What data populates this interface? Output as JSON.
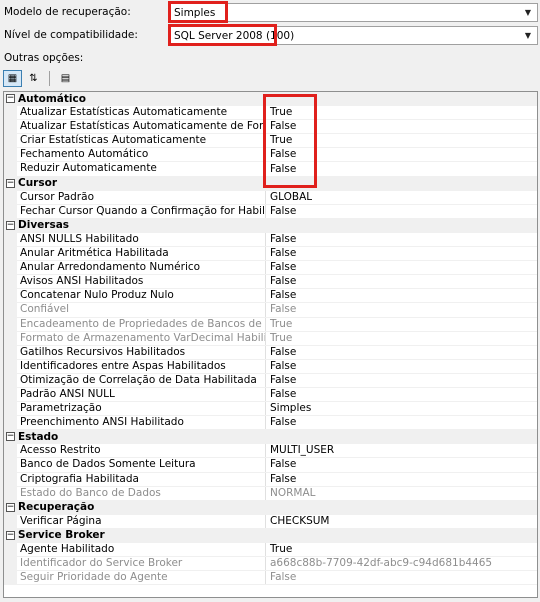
{
  "recovery": {
    "label": "Modelo de recuperação:",
    "value": "Simples"
  },
  "compat": {
    "label": "Nível de compatibilidade:",
    "value": "SQL Server 2008 (100)"
  },
  "other_options_label": "Outras opções:",
  "highlight_color": "#e0201c",
  "categories": [
    {
      "label": "Automático",
      "rows": [
        {
          "name": "Atualizar Estatísticas Automaticamente",
          "value": "True",
          "disabled": false
        },
        {
          "name": "Atualizar Estatísticas Automaticamente de Forma Assíncrona",
          "value": "False",
          "disabled": false
        },
        {
          "name": "Criar Estatísticas Automaticamente",
          "value": "True",
          "disabled": false
        },
        {
          "name": "Fechamento Automático",
          "value": "False",
          "disabled": false
        },
        {
          "name": "Reduzir Automaticamente",
          "value": "False",
          "disabled": false
        }
      ]
    },
    {
      "label": "Cursor",
      "rows": [
        {
          "name": "Cursor Padrão",
          "value": "GLOBAL",
          "disabled": false
        },
        {
          "name": "Fechar Cursor Quando a Confirmação for Habilitada",
          "value": "False",
          "disabled": false
        }
      ]
    },
    {
      "label": "Diversas",
      "rows": [
        {
          "name": "ANSI NULLS Habilitado",
          "value": "False",
          "disabled": false
        },
        {
          "name": "Anular Aritmética Habilitada",
          "value": "False",
          "disabled": false
        },
        {
          "name": "Anular Arredondamento Numérico",
          "value": "False",
          "disabled": false
        },
        {
          "name": "Avisos ANSI Habilitados",
          "value": "False",
          "disabled": false
        },
        {
          "name": "Concatenar Nulo Produz Nulo",
          "value": "False",
          "disabled": false
        },
        {
          "name": "Confiável",
          "value": "False",
          "disabled": true
        },
        {
          "name": "Encadeamento de Propriedades de Bancos de Dados",
          "value": "True",
          "disabled": true
        },
        {
          "name": "Formato de Armazenamento VarDecimal Habilitado",
          "value": "True",
          "disabled": true
        },
        {
          "name": "Gatilhos Recursivos Habilitados",
          "value": "False",
          "disabled": false
        },
        {
          "name": "Identificadores entre Aspas Habilitados",
          "value": "False",
          "disabled": false
        },
        {
          "name": "Otimização de Correlação de Data Habilitada",
          "value": "False",
          "disabled": false
        },
        {
          "name": "Padrão ANSI NULL",
          "value": "False",
          "disabled": false
        },
        {
          "name": "Parametrização",
          "value": "Simples",
          "disabled": false
        },
        {
          "name": "Preenchimento ANSI Habilitado",
          "value": "False",
          "disabled": false
        }
      ]
    },
    {
      "label": "Estado",
      "rows": [
        {
          "name": "Acesso Restrito",
          "value": "MULTI_USER",
          "disabled": false
        },
        {
          "name": "Banco de Dados Somente Leitura",
          "value": "False",
          "disabled": false
        },
        {
          "name": "Criptografia Habilitada",
          "value": "False",
          "disabled": false
        },
        {
          "name": "Estado do Banco de Dados",
          "value": "NORMAL",
          "disabled": true
        }
      ]
    },
    {
      "label": "Recuperação",
      "rows": [
        {
          "name": "Verificar Página",
          "value": "CHECKSUM",
          "disabled": false
        }
      ]
    },
    {
      "label": "Service Broker",
      "rows": [
        {
          "name": "Agente Habilitado",
          "value": "True",
          "disabled": false
        },
        {
          "name": "Identificador do Service Broker",
          "value": "a668c88b-7709-42df-abc9-c94d681b4465",
          "disabled": true
        },
        {
          "name": "Seguir Prioridade do Agente",
          "value": "False",
          "disabled": true
        }
      ]
    }
  ]
}
